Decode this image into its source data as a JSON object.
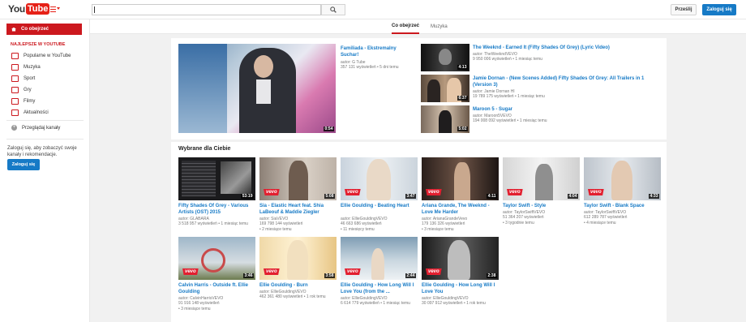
{
  "header": {
    "logo_you": "You",
    "logo_tube": "Tube",
    "search_placeholder": "",
    "upload_label": "Prześlij",
    "signin_label": "Zaloguj się"
  },
  "tabs": [
    {
      "label": "Co obejrzeć",
      "active": true
    },
    {
      "label": "Muzyka",
      "active": false
    }
  ],
  "sidebar": {
    "active_label": "Co obejrzeć",
    "heading": "NAJLEPSZE W YOUTUBE",
    "items": [
      {
        "label": "Popularne w YouTube",
        "icon": "popular-icon"
      },
      {
        "label": "Muzyka",
        "icon": "music-icon"
      },
      {
        "label": "Sport",
        "icon": "sport-icon"
      },
      {
        "label": "Gry",
        "icon": "gaming-icon"
      },
      {
        "label": "Filmy",
        "icon": "movies-icon"
      },
      {
        "label": "Aktualności",
        "icon": "news-icon"
      }
    ],
    "browse_label": "Przeglądaj kanały",
    "promo_text": "Zaloguj się, aby zobaczyć swoje kanały i rekomendacje.",
    "signin_label": "Zaloguj się"
  },
  "featured": {
    "main": {
      "title": "Familiada - Ekstremalny Suchar!",
      "author": "autor: G Tube",
      "views": "357 131 wyświetleń",
      "age": "5 dni temu",
      "duration": "0:54"
    },
    "side": [
      {
        "title": "The Weeknd - Earned It (Fifty Shades Of Grey) (Lyric Video)",
        "author": "autor: TheWeekndVEVO",
        "views": "9 950 006 wyświetleń",
        "age": "1 miesiąc temu",
        "duration": "4:13"
      },
      {
        "title": "Jamie Dornan - (New Scenes Added) Fifty Shades Of Grey: All Trailers in 1 (Version 3)",
        "author": "autor: Jamie Dornan HI",
        "views": "19 789 175 wyświetleń",
        "age": "1 miesiąc temu",
        "duration": "6:37"
      },
      {
        "title": "Maroon 5 - Sugar",
        "author": "autor: Maroon5VEVO",
        "views": "194 008 092 wyświetleń",
        "age": "1 miesiąc temu",
        "duration": "5:02"
      }
    ]
  },
  "recommended": {
    "title": "Wybrane dla Ciebie",
    "videos": [
      {
        "title": "Fifty Shades Of Grey - Various Artists (OST) 2015",
        "author": "autor: GLABARA",
        "views": "3 518 957 wyświetleń",
        "age": "1 miesiąc temu",
        "duration": "53:19",
        "vevo": false
      },
      {
        "title": "Sia - Elastic Heart feat. Shia LaBeouf & Maddie Ziegler (Official Video)",
        "author": "autor: SiaVEVO",
        "views": "169 798 144 wyświetleń",
        "age": "2 miesiące temu",
        "duration": "5:08",
        "vevo": true
      },
      {
        "title": "Ellie Goulding - Beating Heart",
        "author": "autor: ElliеGouldingVEVO",
        "views": "46 663 686 wyświetleń",
        "age": "11 miesięcy temu",
        "duration": "3:47",
        "vevo": true
      },
      {
        "title": "Ariana Grande, The Weeknd - Love Me Harder",
        "author": "autor: ArianaGrandeVevo",
        "views": "179 136 326 wyświetleń",
        "age": "3 miesiące temu",
        "duration": "4:11",
        "vevo": true
      },
      {
        "title": "Taylor Swift - Style",
        "author": "autor: TaylorSwiftVEVO",
        "views": "51 364 207 wyświetleń",
        "age": "3 tygodnie temu",
        "duration": "4:04",
        "vevo": true
      },
      {
        "title": "Taylor Swift - Blank Space",
        "author": "autor: TaylorSwiftVEVO",
        "views": "612 289 787 wyświetleń",
        "age": "4 miesiące temu",
        "duration": "4:33",
        "vevo": true
      },
      {
        "title": "Calvin Harris - Outside ft. Ellie Goulding",
        "author": "autor: CalvinHarrisVEVO",
        "views": "91 916 148 wyświetleń",
        "age": "3 miesiące temu",
        "duration": "3:46",
        "vevo": true
      },
      {
        "title": "Ellie Goulding - Burn",
        "author": "autor: ElliеGouldingVEVO",
        "views": "462 361 480 wyświetleń",
        "age": "1 rok temu",
        "duration": "3:58",
        "vevo": true
      },
      {
        "title": "Ellie Goulding - How Long Will I Love You (from the ...",
        "author": "autor: ElliеGouldingVEVO",
        "views": "6 614 779 wyświetleń",
        "age": "1 miesiąc temu",
        "duration": "2:44",
        "vevo": true
      },
      {
        "title": "Ellie Goulding - How Long Will I Love You",
        "author": "autor: ElliеGouldingVEVO",
        "views": "30 097 912 wyświetleń",
        "age": "1 rok temu",
        "duration": "2:38",
        "vevo": true
      }
    ]
  }
}
